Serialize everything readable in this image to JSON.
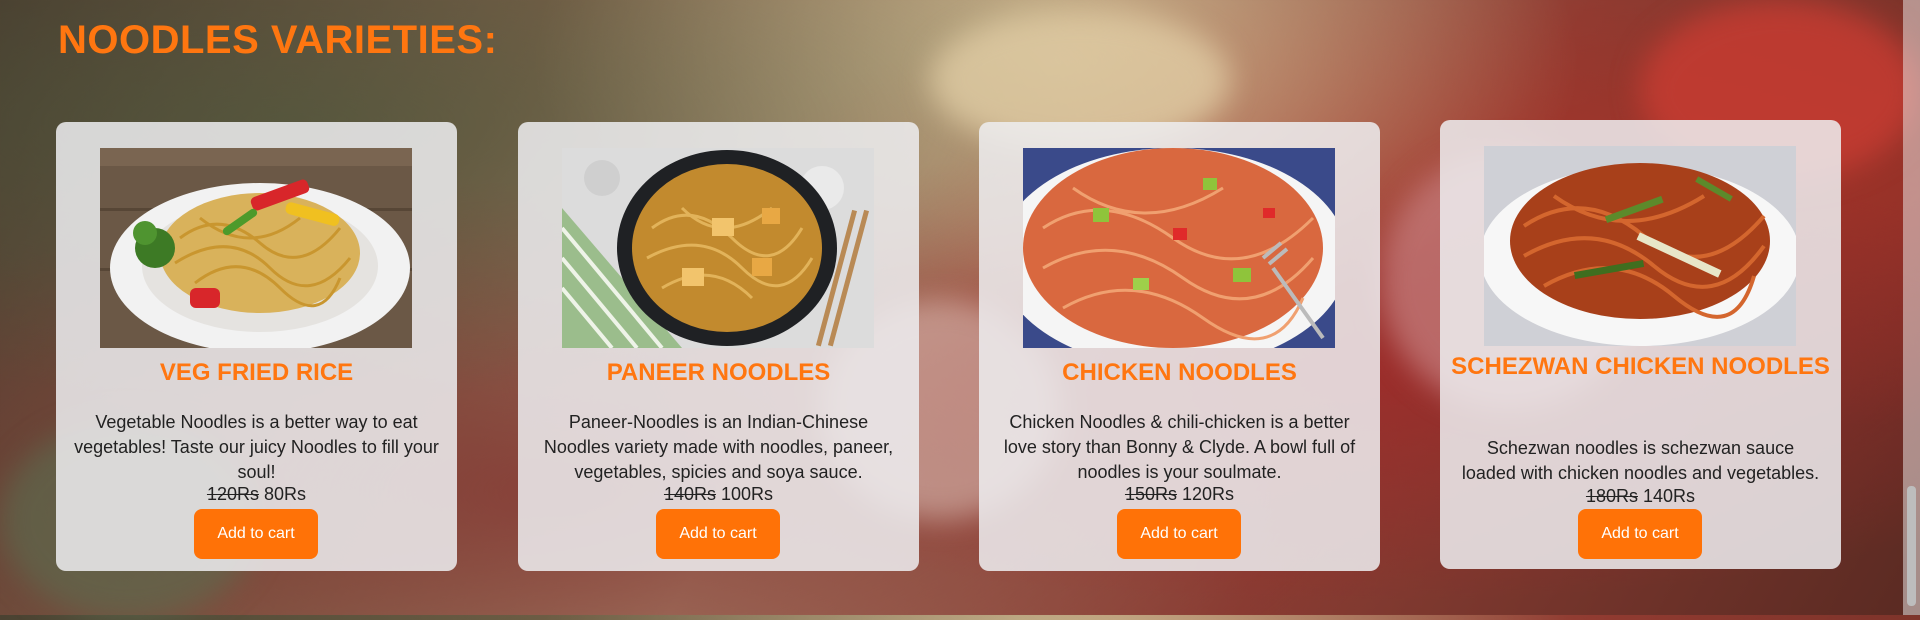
{
  "section": {
    "title": "NOODLES VARIETIES:"
  },
  "cards": [
    {
      "title": "VEG FRIED RICE",
      "description": "Vegetable Noodles is a better way to eat vegetables! Taste our juicy Noodles to fill your soul!",
      "old_price": "120Rs",
      "new_price": "80Rs",
      "button": "Add to cart",
      "image": "veg-noodles-plate"
    },
    {
      "title": "PANEER NOODLES",
      "description": "Paneer-Noodles is an Indian-Chinese Noodles variety made with noodles, paneer, vegetables, spicies and soya sauce.",
      "old_price": "140Rs",
      "new_price": "100Rs",
      "button": "Add to cart",
      "image": "paneer-noodles-bowl"
    },
    {
      "title": "CHICKEN NOODLES",
      "description": "Chicken Noodles & chili-chicken is a better love story than Bonny & Clyde. A bowl full of noodles is your soulmate.",
      "old_price": "150Rs",
      "new_price": "120Rs",
      "button": "Add to cart",
      "image": "chicken-noodles-plate"
    },
    {
      "title": "SCHEZWAN CHICKEN NOODLES",
      "description": "Schezwan noodles is schezwan sauce loaded with chicken noodles and vegetables.",
      "old_price": "180Rs",
      "new_price": "140Rs",
      "button": "Add to cart",
      "image": "schezwan-noodles-plate"
    }
  ],
  "colors": {
    "accent": "#ff7610",
    "button": "#ff7207",
    "card": "#eeeef0"
  }
}
